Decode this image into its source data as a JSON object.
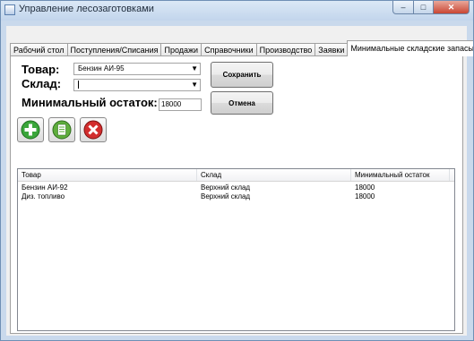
{
  "window": {
    "title": "Управление лесозаготовками"
  },
  "caption": {
    "minimize": "–",
    "maximize": "□",
    "close": "✕"
  },
  "tabs": [
    {
      "label": "Рабочий стол"
    },
    {
      "label": "Поступления/Списания"
    },
    {
      "label": "Продажи"
    },
    {
      "label": "Справочники"
    },
    {
      "label": "Производство"
    },
    {
      "label": "Заявки"
    },
    {
      "label": "Минимальные складские запасы"
    }
  ],
  "form": {
    "product_label": "Товар:",
    "product_value": "Бензин АИ-95",
    "warehouse_label": "Склад:",
    "warehouse_value": "",
    "min_stock_label": "Минимальный остаток:",
    "min_stock_value": "18000",
    "save_label": "Сохранить",
    "cancel_label": "Отмена"
  },
  "icons": {
    "add": "plus-icon",
    "edit": "document-icon",
    "delete": "delete-x-icon"
  },
  "colors": {
    "add": "#3aa63a",
    "edit": "#5fae3c",
    "delete": "#d22d2d"
  },
  "table": {
    "columns": [
      "Товар",
      "Склад",
      "Минимальный остаток"
    ],
    "rows": [
      [
        "Бензин АИ-92",
        "Верхний склад",
        "18000"
      ],
      [
        "Диз. топливо",
        "Верхний склад",
        "18000"
      ]
    ]
  }
}
